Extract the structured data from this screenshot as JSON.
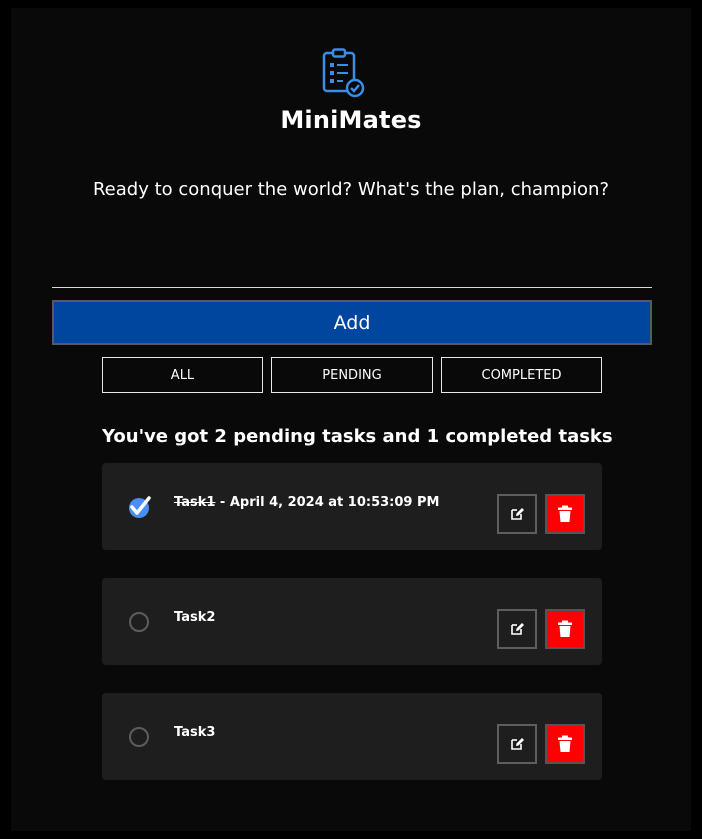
{
  "app": {
    "title": "MiniMates",
    "subtitle": "Ready to conquer the world? What's the plan, champion?",
    "logo_icon": "clipboard-checklist-icon"
  },
  "input": {
    "value": "",
    "placeholder": ""
  },
  "add_button": {
    "label": "Add"
  },
  "filters": [
    {
      "label": "ALL"
    },
    {
      "label": "PENDING"
    },
    {
      "label": "COMPLETED"
    }
  ],
  "summary": "You've got 2 pending tasks and 1 completed tasks",
  "tasks": [
    {
      "name": "Task1",
      "completed": true,
      "timestamp": " - April 4, 2024 at 10:53:09 PM"
    },
    {
      "name": "Task2",
      "completed": false,
      "timestamp": ""
    },
    {
      "name": "Task3",
      "completed": false,
      "timestamp": ""
    }
  ],
  "icons": {
    "edit": "edit-icon",
    "delete": "trash-icon",
    "checked": "checkmark-circle-icon",
    "unchecked": "empty-circle-icon"
  },
  "colors": {
    "background": "#090909",
    "add_button": "#00459e",
    "card": "#1e1e1e",
    "delete": "#ff0000",
    "accent": "#3b82f6"
  }
}
